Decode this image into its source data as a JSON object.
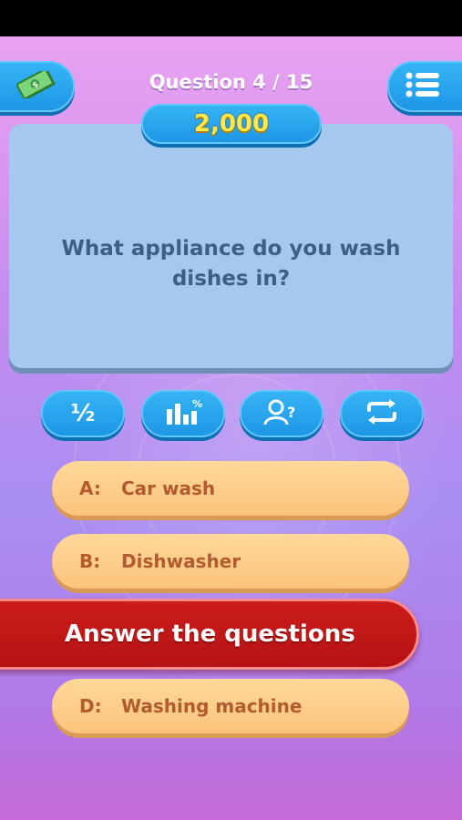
{
  "header": {
    "question_counter": "Question 4 / 15",
    "prize": "2,000"
  },
  "question": {
    "text": "What appliance do you wash dishes in?"
  },
  "lifelines": [
    {
      "label": "½",
      "icon": "fifty-fifty-icon"
    },
    {
      "label": "",
      "icon": "audience-poll-icon"
    },
    {
      "label": "",
      "icon": "ask-expert-icon"
    },
    {
      "label": "",
      "icon": "switch-question-icon"
    }
  ],
  "answers": [
    {
      "letter": "A:",
      "text": "Car wash"
    },
    {
      "letter": "B:",
      "text": "Dishwasher"
    },
    {
      "letter": "D:",
      "text": "Washing machine"
    }
  ],
  "banner": {
    "text": "Answer the questions"
  },
  "colors": {
    "accent_blue": "#1e97e6",
    "prize_gold": "#ffe94a",
    "answer_bg": "#fbc47c",
    "answer_text": "#b35a2e",
    "banner_red": "#b51212",
    "question_card": "#a5c8ef"
  }
}
